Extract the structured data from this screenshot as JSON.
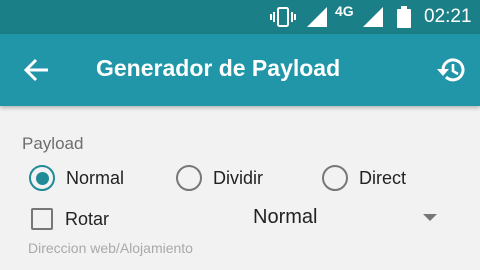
{
  "status_bar": {
    "network_label": "4G",
    "time": "02:21",
    "icons": [
      "vibrate-icon",
      "signal-icon",
      "signal-icon",
      "battery-icon"
    ]
  },
  "toolbar": {
    "back_icon": "arrow-back-icon",
    "title": "Generador de Payload",
    "history_icon": "history-icon"
  },
  "payload": {
    "section_label": "Payload",
    "options": [
      {
        "label": "Normal",
        "checked": true
      },
      {
        "label": "Dividir",
        "checked": false
      },
      {
        "label": "Direct",
        "checked": false
      }
    ],
    "rotar_label": "Rotar",
    "rotar_checked": false,
    "method_value": "Normal",
    "host_hint": "Direccion web/Alojamiento"
  },
  "colors": {
    "status_bar": "#1b7f87",
    "toolbar": "#2196a8",
    "accent": "#218a97",
    "background": "#f2f2f2"
  }
}
